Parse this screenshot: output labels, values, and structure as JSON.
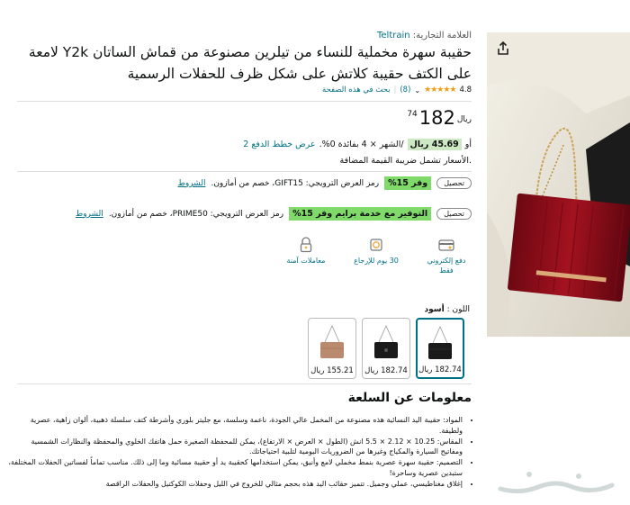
{
  "product": {
    "brand_label": "العلامة التجارية:",
    "brand_name": "Teltrain",
    "title": "حقيبة سهرة مخملية للنساء من تيلرين مصنوعة من قماش الساتان Y2k لامعة على الكتف حقيبة كلاتش على شكل ظرف للحفلات الرسمية",
    "rating": "4.8",
    "stars": "★★★★★",
    "review_count": "(8)",
    "search_link": "بحث في هذه الصفحة"
  },
  "price": {
    "currency": "ريال",
    "whole": "182",
    "fraction": "74"
  },
  "installment": {
    "prefix": "أو",
    "amount": "45.69 ريال",
    "detail": "/الشهر × 4 بفائدة 0%.",
    "link": "عرض خطط الدفع 2"
  },
  "vat_note": ".الأسعار تشمل ضريبة القيمة المضافة",
  "coupons": [
    {
      "button": "تحصيل",
      "badge": "وفر 15%",
      "text": "رمز العرض الترويجي: GIFT15، خصم من أمازون.",
      "link": "الشروط"
    },
    {
      "button": "تحصيل",
      "badge": "التوفير مع خدمة برايم وفر 15%",
      "text": "رمز العرض الترويجي: PRIME50، خصم من أمازون.",
      "link": "الشروط"
    }
  ],
  "features": [
    {
      "label": "دفع إلكتروني فقط",
      "icon": "card-icon"
    },
    {
      "label": "30 يوم للإرجاع",
      "icon": "return-icon"
    },
    {
      "label": "معاملات آمنة",
      "icon": "lock-icon"
    }
  ],
  "color": {
    "label": "اللون :",
    "selected": "أسود"
  },
  "swatches": [
    {
      "price": "182.74 ريال",
      "color": "#1a1a1a",
      "selected": true
    },
    {
      "price": "182.74 ريال",
      "color": "#1a1a1a",
      "selected": false
    },
    {
      "price": "155.21 ريال",
      "color": "#b98a6e",
      "selected": false
    }
  ],
  "about": {
    "heading": "معلومات عن السلعة",
    "bullets": [
      "المواد: حقيبة اليد النسائية هذه مصنوعة من المخمل عالي الجودة، ناعمة وسلسة، مع جليتر بلوري وأشرطة كتف سلسلة ذهبية، ألوان زاهية، عصرية ولطيفة.",
      "المقاس: 10.25 × 2.12 × 5.5 انش (الطول × العرض × الارتفاع)، يمكن للمحفظة الصغيرة حمل هاتفك الخلوي والمحفظة والنظارات الشمسية ومفاتيح السيارة والمكياج وغيرها من الضروريات اليومية لتلبية احتياجاتك.",
      "التصميم: حقيبة سهرة عصرية بنمط مخملي لامع وأنيق، يمكن استخدامها كحقيبة يد أو حقيبة مسائية وما إلى ذلك. مناسب تماماً لفساتين الحفلات المختلفة، ستبدين عصرية وساحرة!",
      "إغلاق مغناطيسي، عملي وجميل. تتميز حقائب اليد هذه بحجم مثالي للخروج في الليل وحفلات الكوكتيل والحفلات الراقصة"
    ]
  },
  "colors": {
    "link": "#007185",
    "green_badge": "#7fda69",
    "velvet_red": "#8e0e1c"
  }
}
